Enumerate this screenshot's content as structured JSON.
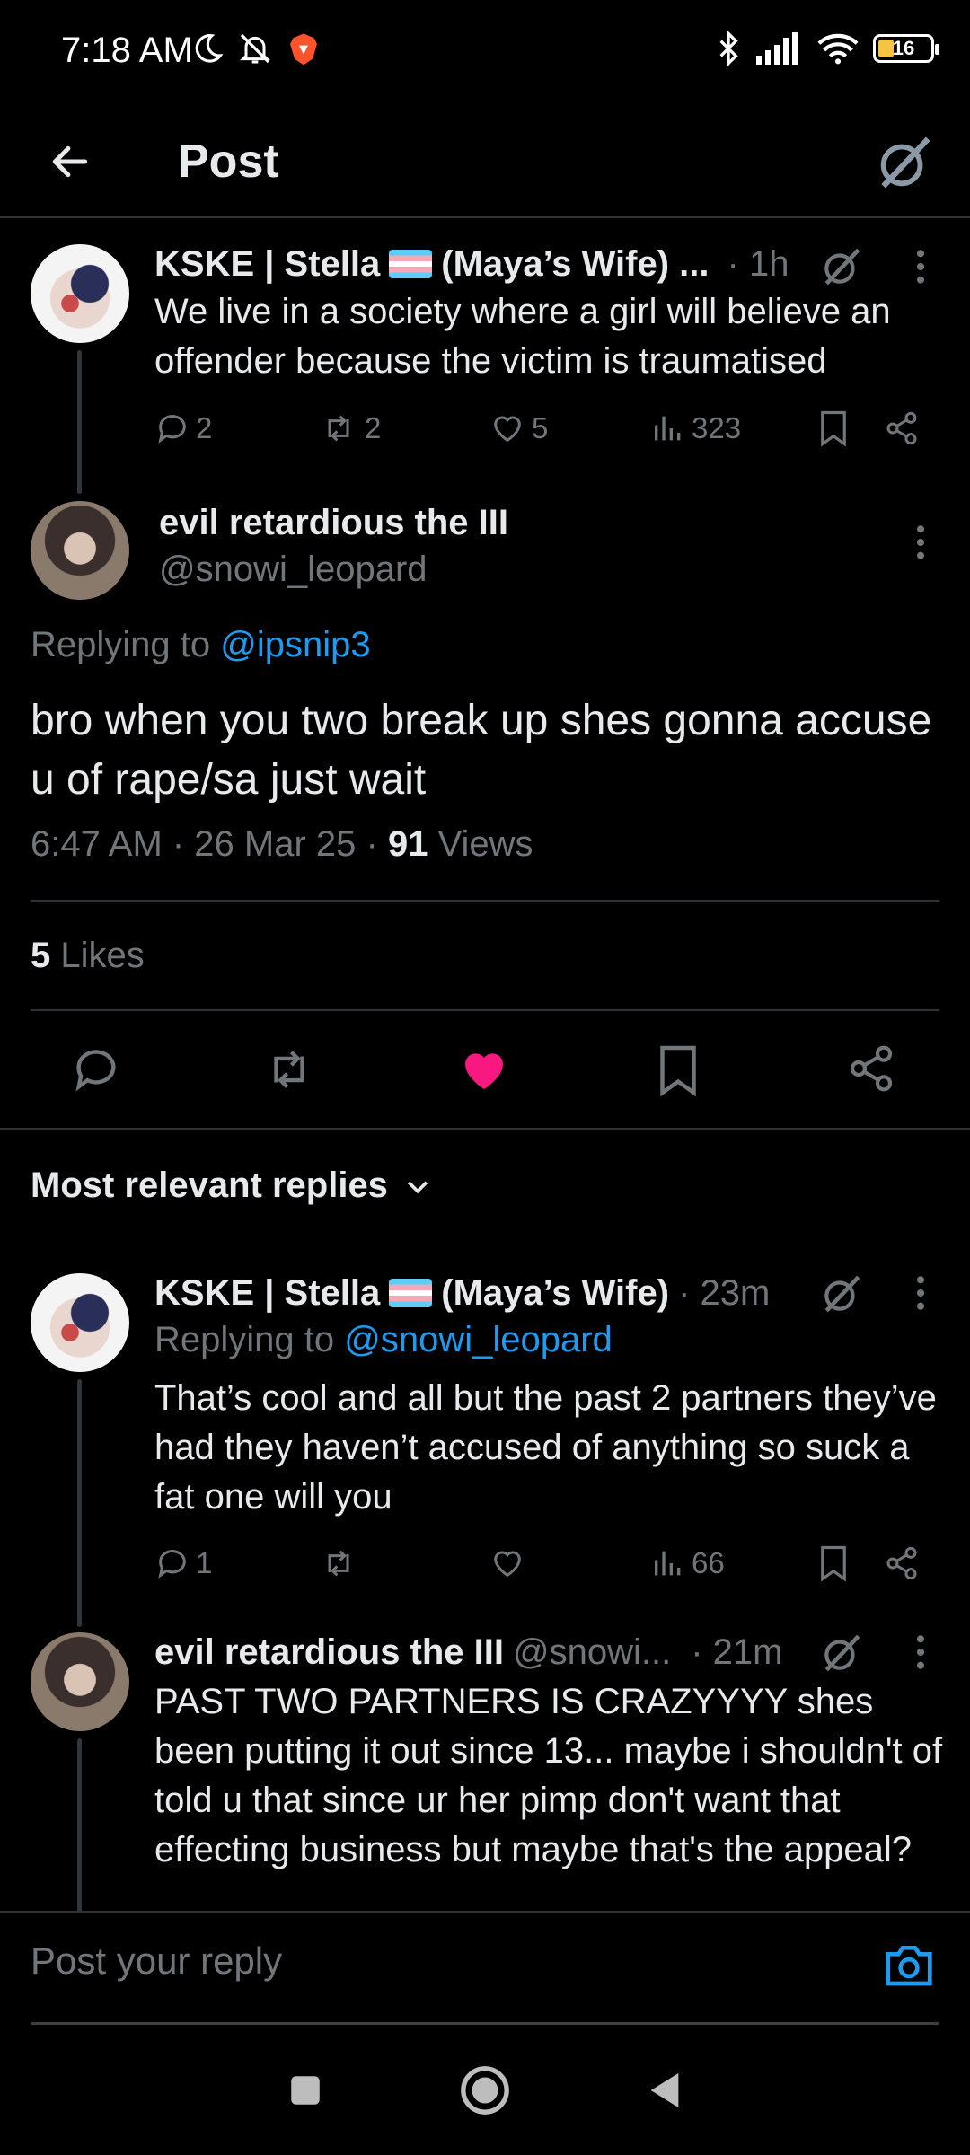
{
  "status_bar": {
    "time": "7:18 AM",
    "battery": "16"
  },
  "header": {
    "title": "Post"
  },
  "parent_post": {
    "author": "KSKE | Stella",
    "author_suffix": "(Maya’s Wife) ...",
    "time": "· 1h",
    "text": "We live in a society where a girl will believe an offender because the victim is traumatised",
    "replies": "2",
    "reposts": "2",
    "likes": "5",
    "views": "323"
  },
  "main_post": {
    "author": "evil retardious the III",
    "handle": "@snowi_leopard",
    "replying_prefix": "Replying to",
    "replying_handle": "@ipsnip3",
    "text": "bro when you two break up shes gonna accuse u of rape/sa just wait",
    "timestamp": "6:47 AM · 26 Mar 25 · ",
    "views_count": "91",
    "views_label": " Views",
    "likes_count": "5",
    "likes_label": " Likes"
  },
  "replies_section": {
    "sort_label": "Most relevant replies"
  },
  "reply_1": {
    "author": "KSKE | Stella",
    "author_suffix": "(Maya’s Wife)",
    "time": "· 23m",
    "replying_prefix": "Replying to",
    "replying_handle": "@snowi_leopard",
    "text": "That’s cool and all but the past 2 partners they’ve had they haven’t accused of anything so suck a fat one will you",
    "replies": "1",
    "reposts": "",
    "likes": "",
    "views": "66"
  },
  "reply_2": {
    "author": "evil retardious the III",
    "handle": "@snowi...",
    "time": "· 21m",
    "text": "PAST TWO PARTNERS IS CRAZYYYY shes been putting it out since 13... maybe i shouldn't of told u that since ur her pimp don't want that effecting business but maybe that's the appeal?"
  },
  "composer": {
    "placeholder": "Post your reply"
  },
  "colors": {
    "accent": "#1d9bf0",
    "like": "#f91880",
    "text": "#e7e9ea",
    "muted": "#71767b",
    "divider": "#2f3336"
  }
}
